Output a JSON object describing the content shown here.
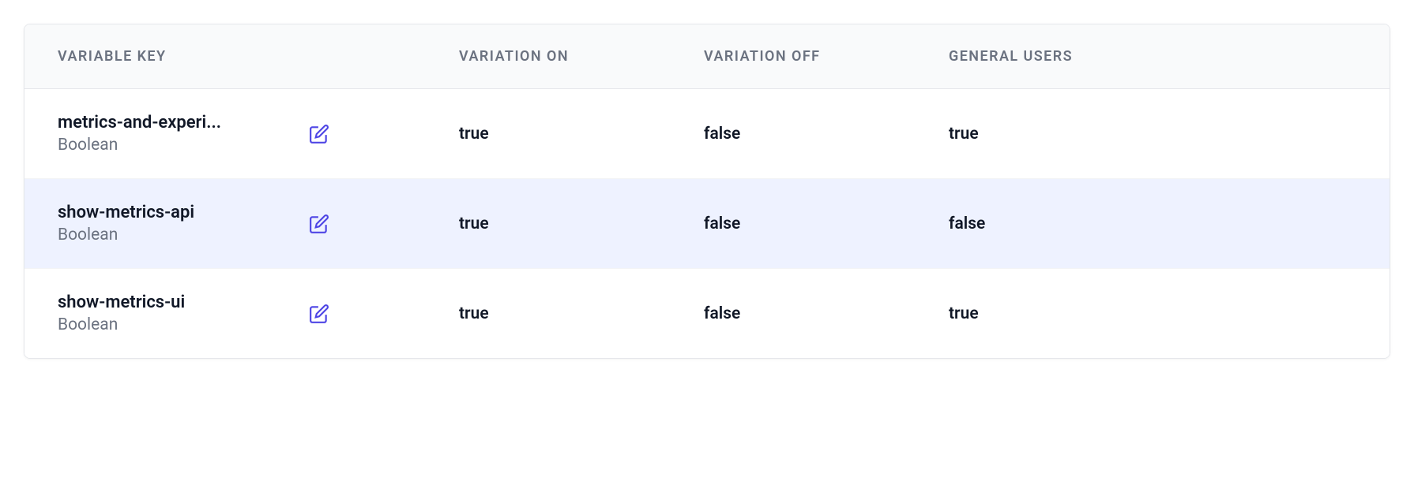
{
  "headers": {
    "variable_key": "VARIABLE KEY",
    "variation_on": "VARIATION ON",
    "variation_off": "VARIATION OFF",
    "general_users": "GENERAL USERS"
  },
  "rows": [
    {
      "key": "metrics-and-experi...",
      "type": "Boolean",
      "variation_on": "true",
      "variation_off": "false",
      "general_users": "true",
      "selected": false
    },
    {
      "key": "show-metrics-api",
      "type": "Boolean",
      "variation_on": "true",
      "variation_off": "false",
      "general_users": "false",
      "selected": true
    },
    {
      "key": "show-metrics-ui",
      "type": "Boolean",
      "variation_on": "true",
      "variation_off": "false",
      "general_users": "true",
      "selected": false
    }
  ]
}
